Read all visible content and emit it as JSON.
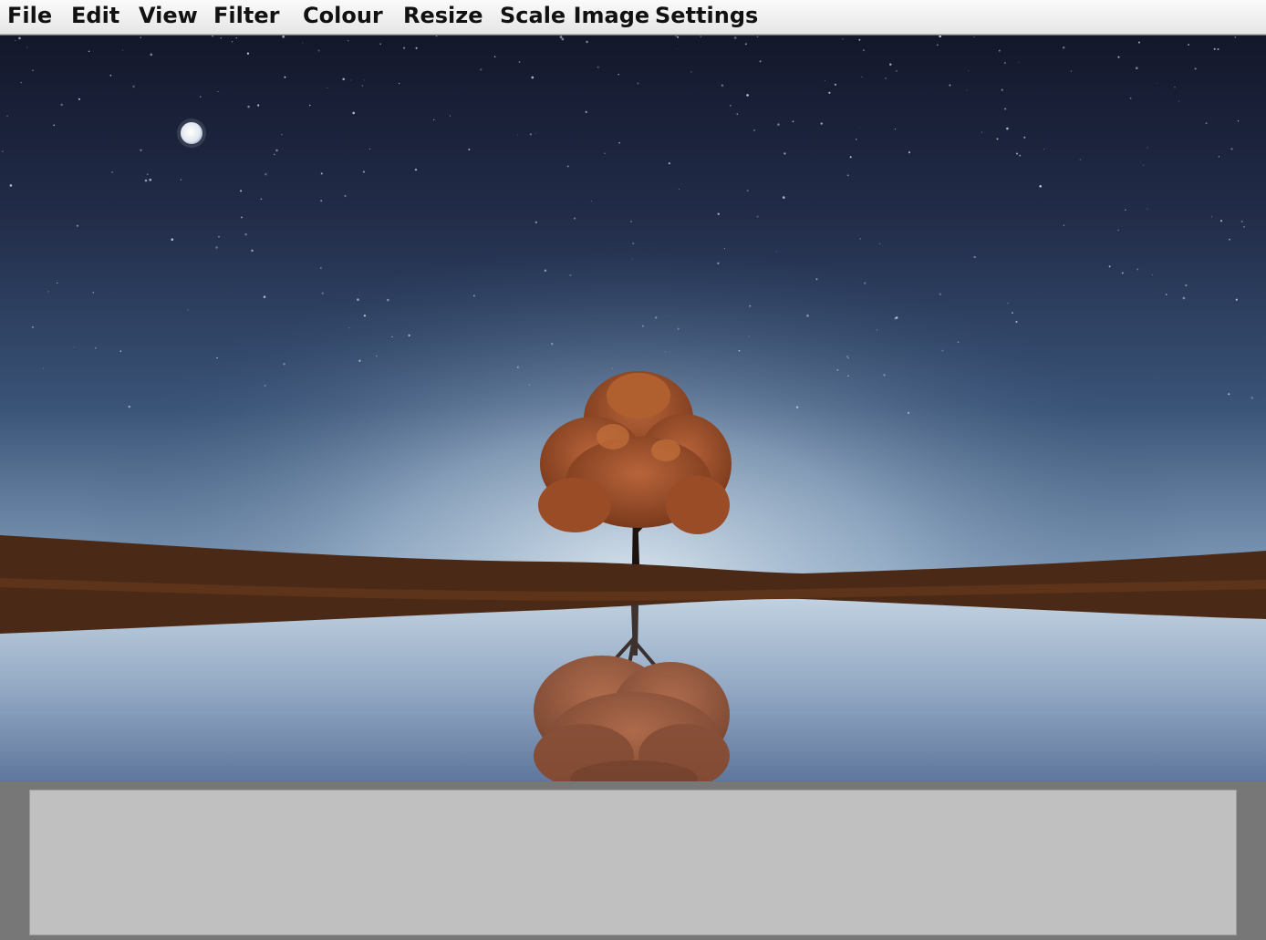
{
  "menu": {
    "file": "File",
    "edit": "Edit",
    "view": "View",
    "filter": "Filter",
    "colour": "Colour",
    "resize": "Resize",
    "scale_image": "Scale Image",
    "settings": "Settings"
  },
  "image": {
    "subject": "night-sky-lone-tree-lake-reflection",
    "colors": {
      "sky_top": "#14182a",
      "sky_mid": "#3a5680",
      "horizon_glow": "#c9d9e6",
      "foliage": "#a2532a",
      "ground": "#4a2a16",
      "water": "#9fb4cc"
    }
  },
  "output_area": {
    "text": ""
  }
}
